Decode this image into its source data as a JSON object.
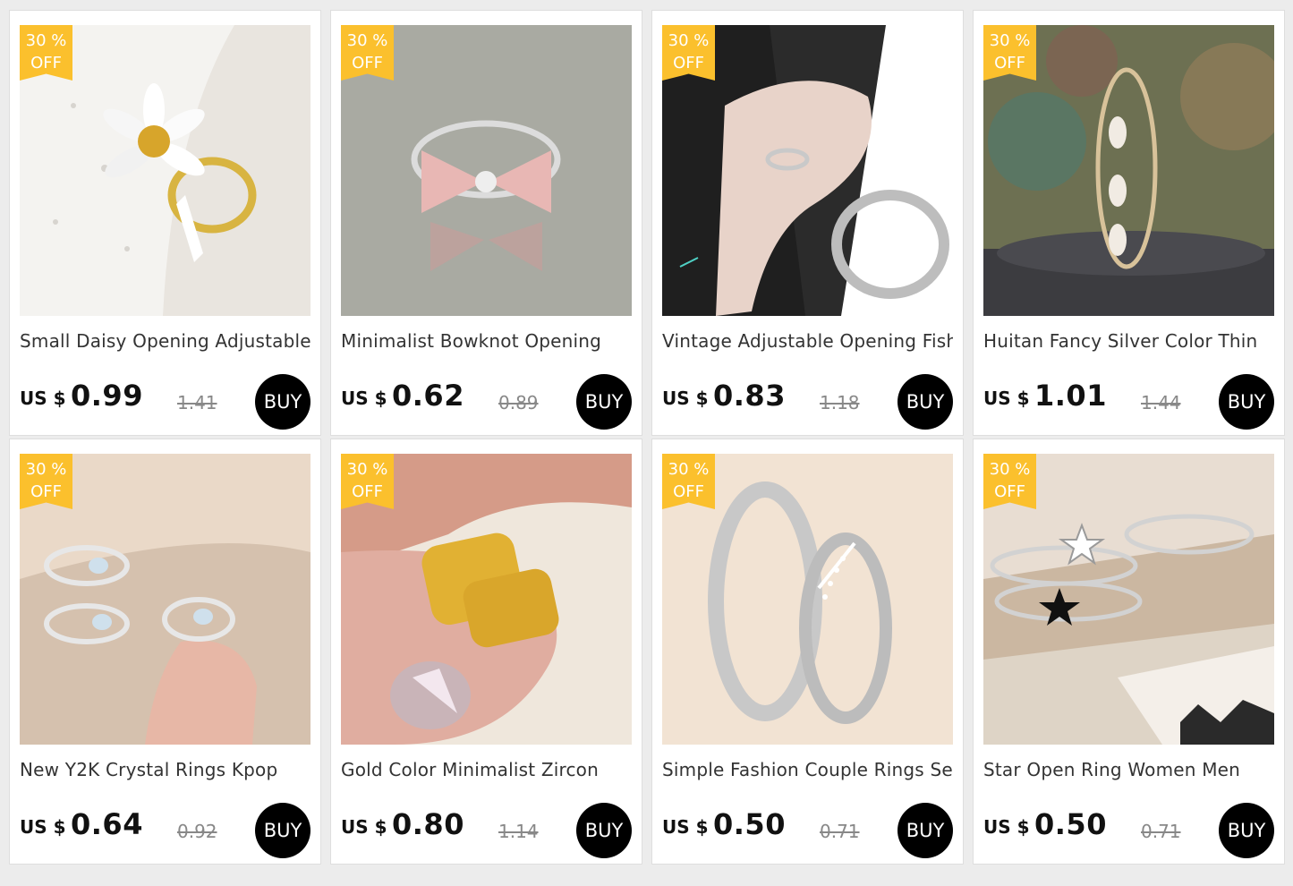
{
  "products": [
    {
      "discount_pct": "30 %",
      "discount_off": "OFF",
      "title": "Small Daisy Opening Adjustable",
      "currency": "US $",
      "price": "0.99",
      "old_price": "1.41",
      "buy_label": "BUY",
      "image_icon": "daisy-ring-image",
      "colors": {
        "bg": "#e9e5df",
        "accent": "#ffffff",
        "metal": "#d8b441"
      }
    },
    {
      "discount_pct": "30 %",
      "discount_off": "OFF",
      "title": "Minimalist Bowknot Opening",
      "currency": "US $",
      "price": "0.62",
      "old_price": "0.89",
      "buy_label": "BUY",
      "image_icon": "bowknot-ring-image",
      "colors": {
        "bg": "#a9aaa2",
        "accent": "#e8b7b4",
        "metal": "#d6d6d6"
      }
    },
    {
      "discount_pct": "30 %",
      "discount_off": "OFF",
      "title": "Vintage Adjustable Opening Fish",
      "currency": "US $",
      "price": "0.83",
      "old_price": "1.18",
      "buy_label": "BUY",
      "image_icon": "fish-ring-image",
      "colors": {
        "bg": "#2b2b2b",
        "accent": "#e8d3c9",
        "metal": "#c9c9c9"
      }
    },
    {
      "discount_pct": "30 %",
      "discount_off": "OFF",
      "title": "Huitan Fancy Silver Color Thin",
      "currency": "US $",
      "price": "1.01",
      "old_price": "1.44",
      "buy_label": "BUY",
      "image_icon": "thin-silver-ring-image",
      "colors": {
        "bg": "#6d7052",
        "accent": "#f1ebe3",
        "metal": "#d8c29a"
      }
    },
    {
      "discount_pct": "30 %",
      "discount_off": "OFF",
      "title": "New Y2K Crystal Rings Kpop",
      "currency": "US $",
      "price": "0.64",
      "old_price": "0.92",
      "buy_label": "BUY",
      "image_icon": "crystal-rings-image",
      "colors": {
        "bg": "#d5c1ae",
        "accent": "#cfe0ec",
        "metal": "#e7e7e7"
      }
    },
    {
      "discount_pct": "30 %",
      "discount_off": "OFF",
      "title": "Gold Color Minimalist Zircon",
      "currency": "US $",
      "price": "0.80",
      "old_price": "1.14",
      "buy_label": "BUY",
      "image_icon": "gold-rings-image",
      "colors": {
        "bg": "#efe7dc",
        "accent": "#d59b88",
        "metal": "#e1b133"
      }
    },
    {
      "discount_pct": "30 %",
      "discount_off": "OFF",
      "title": "Simple Fashion Couple Rings Set",
      "currency": "US $",
      "price": "0.50",
      "old_price": "0.71",
      "buy_label": "BUY",
      "image_icon": "couple-rings-image",
      "colors": {
        "bg": "#f2e3d3",
        "accent": "#ffffff",
        "metal": "#c8c8c8"
      }
    },
    {
      "discount_pct": "30 %",
      "discount_off": "OFF",
      "title": "Star Open Ring Women Men",
      "currency": "US $",
      "price": "0.50",
      "old_price": "0.71",
      "buy_label": "BUY",
      "image_icon": "star-rings-image",
      "colors": {
        "bg": "#cbb7a1",
        "accent": "#f4efe9",
        "metal": "#d2d2d2"
      }
    }
  ],
  "theme": {
    "badge": "#fbc02d",
    "buy_button": "#000000",
    "page_bg": "#ececec"
  }
}
